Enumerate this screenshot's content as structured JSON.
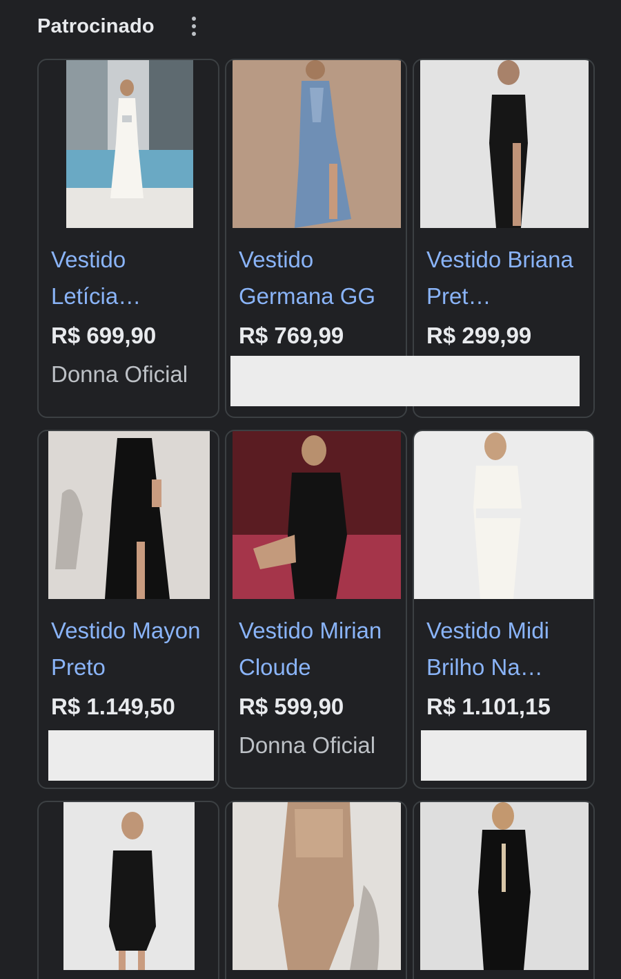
{
  "header": {
    "title": "Patrocinado",
    "menu_icon": "kebab-menu-icon"
  },
  "products": [
    {
      "title": "Vestido Letícia…",
      "price": "R$ 699,90",
      "merchant": "Donna Oficial",
      "image": "white cutout gown by pool"
    },
    {
      "title": "Vestido Germana GG",
      "price": "R$ 769,99",
      "merchant": "",
      "image": "blue satin draped gown"
    },
    {
      "title": "Vestido Briana Pret…",
      "price": "R$ 299,99",
      "merchant": "",
      "image": "black corset slit gown"
    },
    {
      "title": "Vestido Mayon Preto",
      "price": "R$ 1.149,50",
      "merchant": "",
      "image": "black cutout maxi dress"
    },
    {
      "title": "Vestido Mirian Cloude",
      "price": "R$ 599,90",
      "merchant": "Donna Oficial",
      "image": "black sequin mini dress on red stairs"
    },
    {
      "title": "Vestido Midi Brilho Na…",
      "price": "R$ 1.101,15",
      "merchant": "",
      "image": "white cutout mini dress"
    },
    {
      "title": "",
      "price": "",
      "merchant": "",
      "image": "black lace mini dress"
    },
    {
      "title": "",
      "price": "",
      "merchant": "",
      "image": "gold sequin wrap dress"
    },
    {
      "title": "",
      "price": "",
      "merchant": "",
      "image": "black keyhole mini dress"
    }
  ],
  "colors": {
    "background": "#202124",
    "link": "#8ab4f8",
    "text": "#e8eaed",
    "secondary": "#bdc1c6",
    "border": "#3c4043"
  }
}
